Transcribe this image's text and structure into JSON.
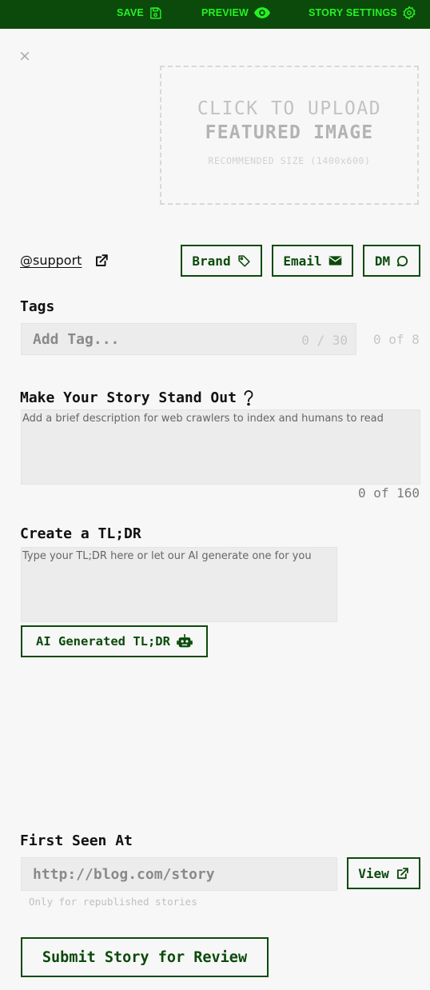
{
  "topbar": {
    "save_label": "SAVE",
    "preview_label": "PREVIEW",
    "settings_label": "STORY SETTINGS",
    "bg_color": "#0b4a0b",
    "text_color": "#25f225"
  },
  "close_label": "×",
  "upload": {
    "line1": "CLICK TO UPLOAD",
    "line2": "FEATURED IMAGE",
    "line3": "RECOMMENDED SIZE (1400x600)"
  },
  "author": {
    "handle": "@support",
    "buttons": {
      "brand": "Brand",
      "email": "Email",
      "dm": "DM"
    }
  },
  "tags": {
    "label": "Tags",
    "placeholder": "Add Tag...",
    "char_count": "0 / 30",
    "tag_count": "0 of 8"
  },
  "description": {
    "label": "Make Your Story Stand Out",
    "placeholder": "Add a brief description for web crawlers to index and humans to read",
    "count": "0 of 160"
  },
  "tldr": {
    "label": "Create a TL;DR",
    "placeholder": "Type your TL;DR here or let our AI generate one for you",
    "ai_button": "AI Generated TL;DR"
  },
  "first_seen": {
    "label": "First Seen At",
    "placeholder": "http://blog.com/story",
    "view_button": "View",
    "hint": "Only for republished stories"
  },
  "submit_label": "Submit Story for Review",
  "icons": [
    "save-icon",
    "eye-icon",
    "gear-icon",
    "close-icon",
    "external-link-icon",
    "tag-icon",
    "envelope-icon",
    "chat-bubble-icon",
    "question-icon",
    "robot-icon"
  ]
}
